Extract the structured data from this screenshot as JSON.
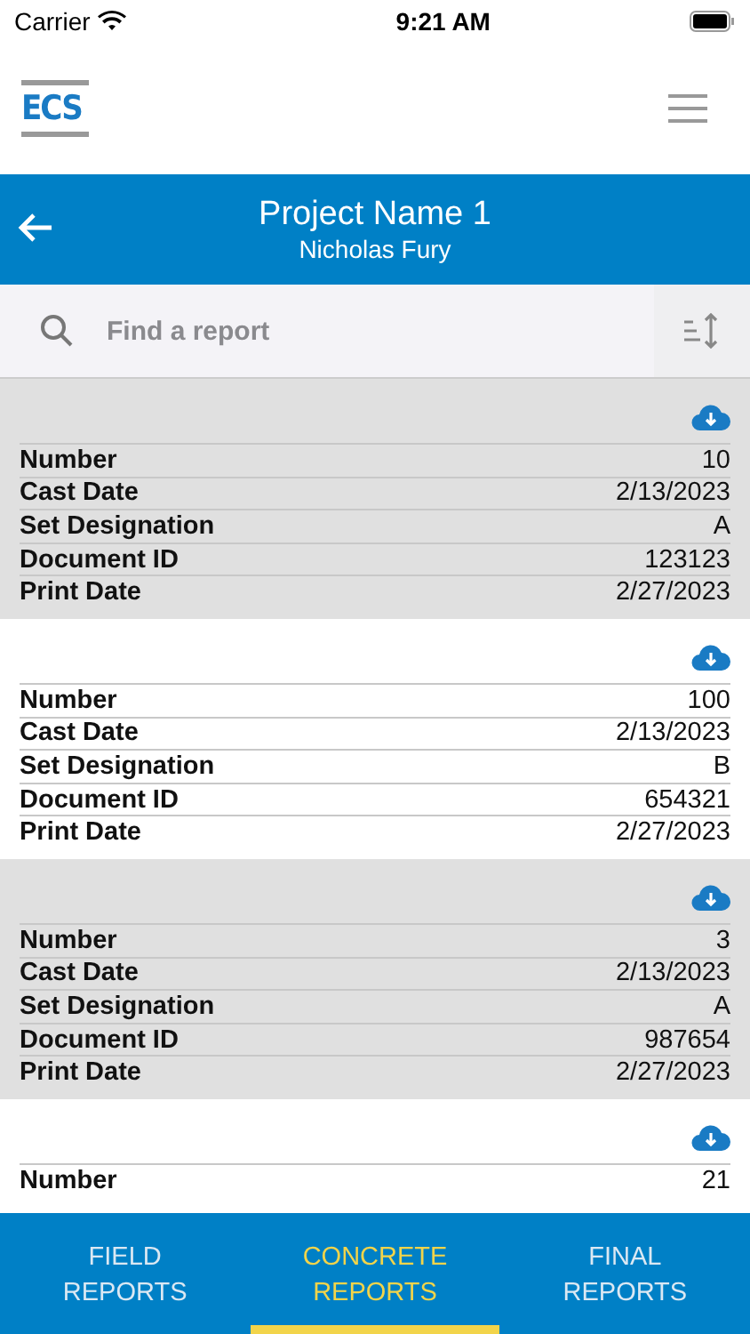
{
  "status_bar": {
    "carrier": "Carrier",
    "time": "9:21 AM"
  },
  "header": {
    "logo": "ECS"
  },
  "project_bar": {
    "title": "Project Name 1",
    "subtitle": "Nicholas Fury"
  },
  "search": {
    "placeholder": "Find a report"
  },
  "reports": [
    {
      "fields": [
        {
          "label": "Number",
          "value": "10"
        },
        {
          "label": "Cast Date",
          "value": "2/13/2023"
        },
        {
          "label": "Set Designation",
          "value": "A"
        },
        {
          "label": "Document ID",
          "value": "123123"
        },
        {
          "label": "Print Date",
          "value": "2/27/2023"
        }
      ]
    },
    {
      "fields": [
        {
          "label": "Number",
          "value": "100"
        },
        {
          "label": "Cast Date",
          "value": "2/13/2023"
        },
        {
          "label": "Set Designation",
          "value": "B"
        },
        {
          "label": "Document ID",
          "value": "654321"
        },
        {
          "label": "Print Date",
          "value": "2/27/2023"
        }
      ]
    },
    {
      "fields": [
        {
          "label": "Number",
          "value": "3"
        },
        {
          "label": "Cast Date",
          "value": "2/13/2023"
        },
        {
          "label": "Set Designation",
          "value": "A"
        },
        {
          "label": "Document ID",
          "value": "987654"
        },
        {
          "label": "Print Date",
          "value": "2/27/2023"
        }
      ]
    },
    {
      "fields": [
        {
          "label": "Number",
          "value": "21"
        }
      ]
    }
  ],
  "tabs": [
    {
      "label": "FIELD\nREPORTS",
      "selected": false
    },
    {
      "label": "CONCRETE\nREPORTS",
      "selected": true
    },
    {
      "label": "FINAL\nREPORTS",
      "selected": false
    }
  ]
}
